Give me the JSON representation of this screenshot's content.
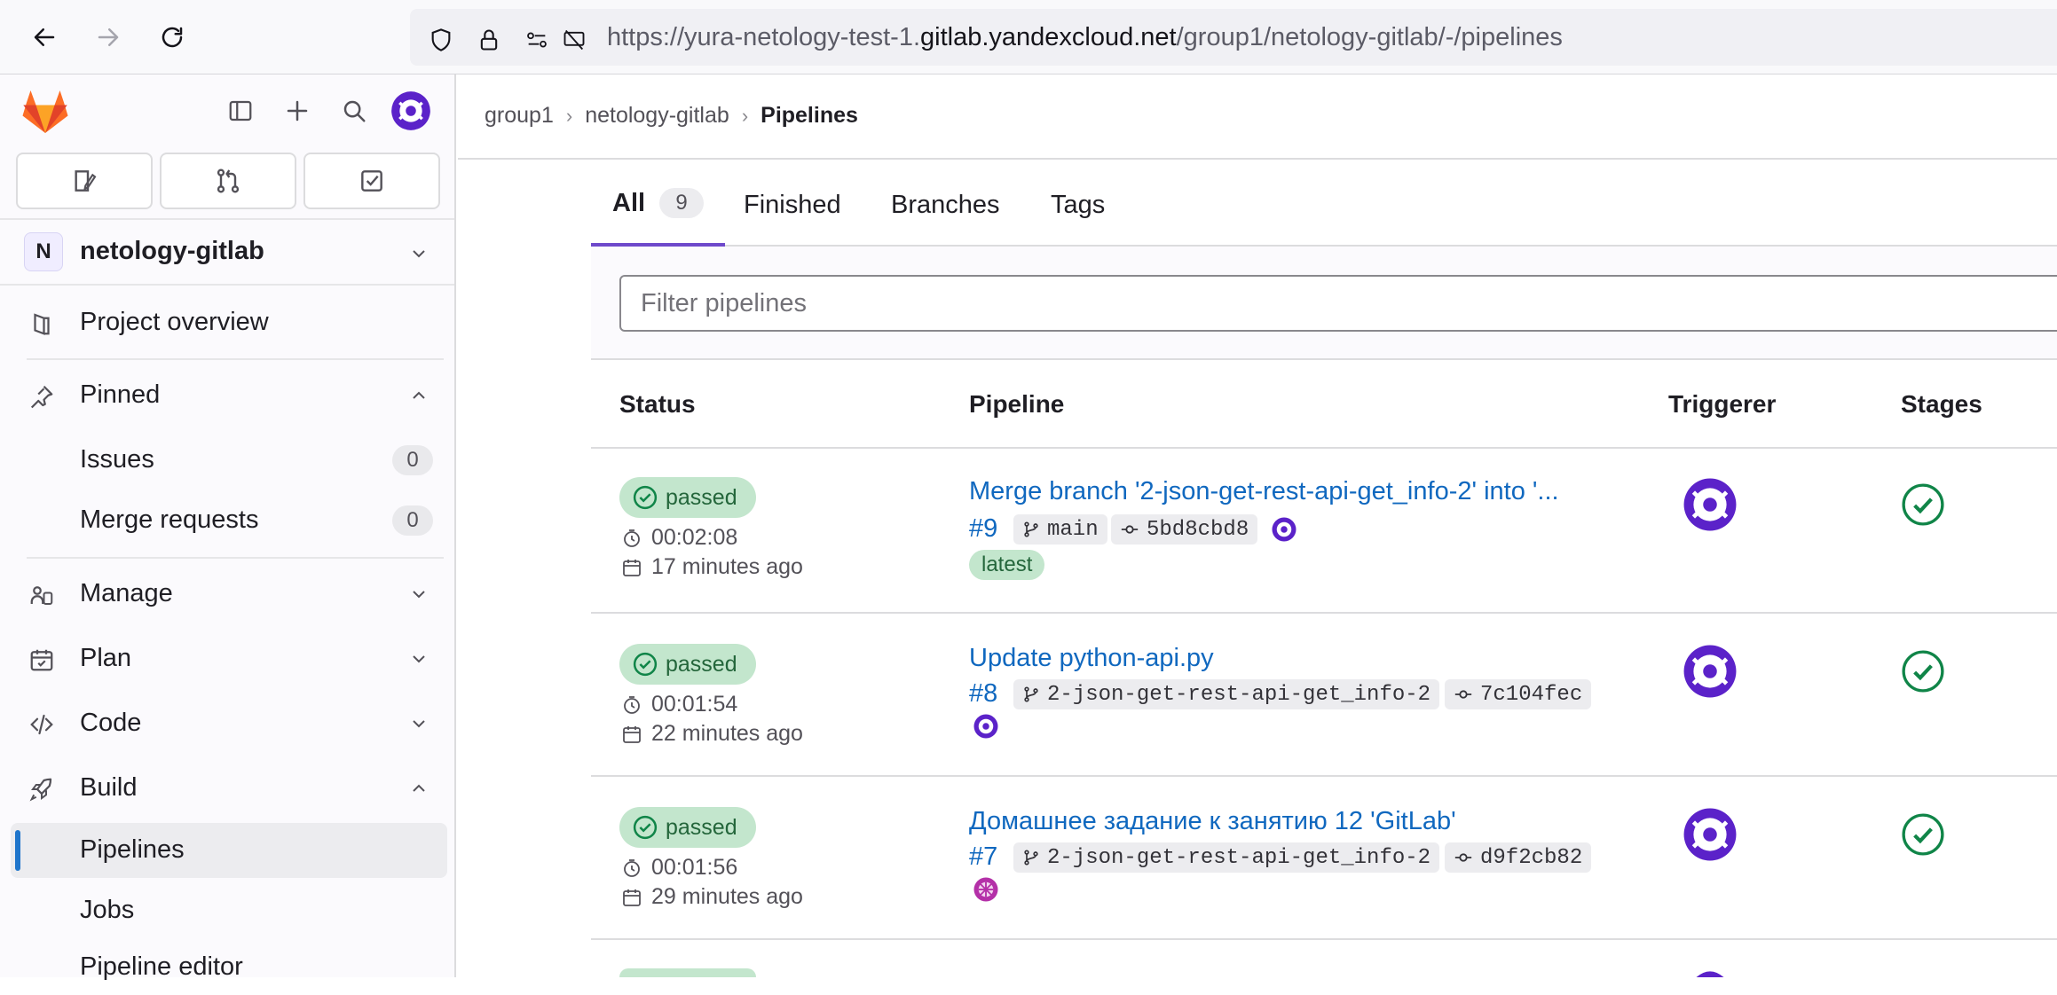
{
  "browser": {
    "url_prefix": "https://yura-netology-test-1.",
    "url_host": "gitlab.yandexcloud.net",
    "url_path": "/group1/netology-gitlab/-/pipelines"
  },
  "sidebar": {
    "project_initial": "N",
    "project_name": "netology-gitlab",
    "overview": "Project overview",
    "pinned": "Pinned",
    "pinned_items": [
      {
        "label": "Issues",
        "count": "0"
      },
      {
        "label": "Merge requests",
        "count": "0"
      }
    ],
    "sections": [
      "Manage",
      "Plan",
      "Code",
      "Build"
    ],
    "build_items": [
      "Pipelines",
      "Jobs",
      "Pipeline editor"
    ]
  },
  "breadcrumb": [
    "group1",
    "netology-gitlab",
    "Pipelines"
  ],
  "tabs": [
    {
      "label": "All",
      "count": "9"
    },
    {
      "label": "Finished"
    },
    {
      "label": "Branches"
    },
    {
      "label": "Tags"
    }
  ],
  "filter": {
    "placeholder": "Filter pipelines"
  },
  "table": {
    "headers": [
      "Status",
      "Pipeline",
      "Triggerer",
      "Stages"
    ],
    "rows": [
      {
        "status": "passed",
        "duration": "00:02:08",
        "ago": "17 minutes ago",
        "title": "Merge branch '2-json-get-rest-api-get_info-2' into '...",
        "id": "#9",
        "branch": "main",
        "commit": "5bd8cbd8",
        "tag": "latest"
      },
      {
        "status": "passed",
        "duration": "00:01:54",
        "ago": "22 minutes ago",
        "title": "Update python-api.py",
        "id": "#8",
        "branch": "2-json-get-rest-api-get_info-2",
        "commit": "7c104fec"
      },
      {
        "status": "passed",
        "duration": "00:01:56",
        "ago": "29 minutes ago",
        "title": "Домашнее задание к занятию 12 'GitLab'",
        "id": "#7",
        "branch": "2-json-get-rest-api-get_info-2",
        "commit": "d9f2cb82"
      }
    ]
  },
  "colors": {
    "link": "#1068bf",
    "success": "#108548",
    "accent": "#6e49cb",
    "avatar": "#5b22c9"
  }
}
